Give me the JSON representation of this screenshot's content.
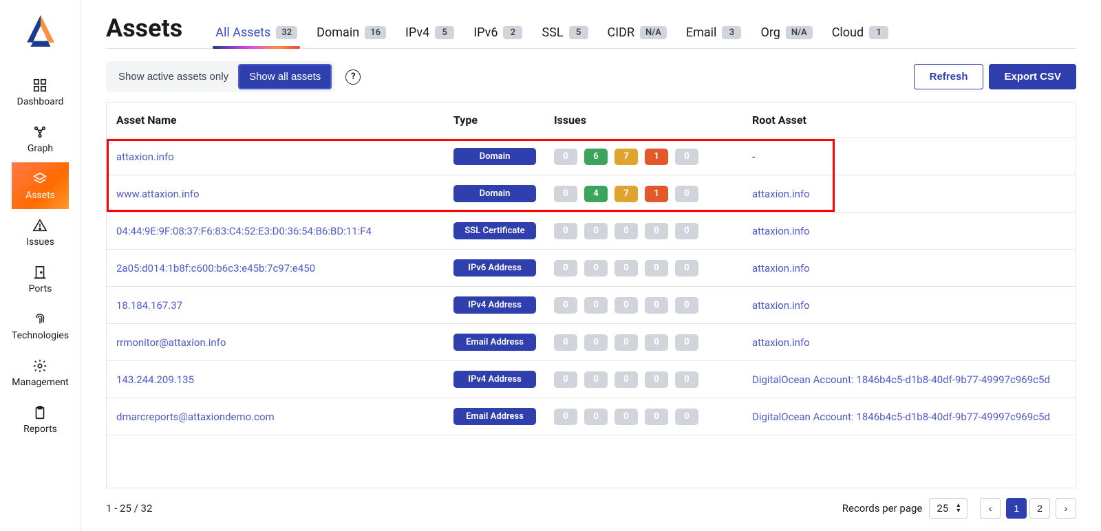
{
  "sidebar": {
    "items": [
      {
        "label": "Dashboard",
        "icon": "dashboard-icon"
      },
      {
        "label": "Graph",
        "icon": "graph-icon"
      },
      {
        "label": "Assets",
        "icon": "layers-icon",
        "active": true
      },
      {
        "label": "Issues",
        "icon": "alert-icon"
      },
      {
        "label": "Ports",
        "icon": "door-icon"
      },
      {
        "label": "Technologies",
        "icon": "fingerprint-icon"
      },
      {
        "label": "Management",
        "icon": "gear-icon"
      },
      {
        "label": "Reports",
        "icon": "clipboard-icon"
      }
    ]
  },
  "header": {
    "title": "Assets",
    "tabs": [
      {
        "label": "All Assets",
        "count": "32",
        "active": true
      },
      {
        "label": "Domain",
        "count": "16"
      },
      {
        "label": "IPv4",
        "count": "5"
      },
      {
        "label": "IPv6",
        "count": "2"
      },
      {
        "label": "SSL",
        "count": "5"
      },
      {
        "label": "CIDR",
        "count": "N/A"
      },
      {
        "label": "Email",
        "count": "3"
      },
      {
        "label": "Org",
        "count": "N/A"
      },
      {
        "label": "Cloud",
        "count": "1"
      }
    ]
  },
  "toolbar": {
    "show_active_label": "Show active assets only",
    "show_all_label": "Show all assets",
    "help_symbol": "?",
    "refresh_label": "Refresh",
    "export_label": "Export CSV"
  },
  "table": {
    "columns": {
      "name": "Asset Name",
      "type": "Type",
      "issues": "Issues",
      "root": "Root Asset"
    },
    "rows": [
      {
        "name": "attaxion.info",
        "type": "Domain",
        "issues": [
          "0",
          "6",
          "7",
          "1",
          "0"
        ],
        "issue_colors": [
          "gray",
          "green",
          "yellow",
          "orange",
          "gray"
        ],
        "root": "-"
      },
      {
        "name": "www.attaxion.info",
        "type": "Domain",
        "issues": [
          "0",
          "4",
          "7",
          "1",
          "0"
        ],
        "issue_colors": [
          "gray",
          "green",
          "yellow",
          "orange",
          "gray"
        ],
        "root": "attaxion.info"
      },
      {
        "name": "04:44:9E:9F:08:37:F6:83:C4:52:E3:D0:36:54:B6:BD:11:F4",
        "type": "SSL Certificate",
        "issues": [
          "0",
          "0",
          "0",
          "0",
          "0"
        ],
        "issue_colors": [
          "gray",
          "gray",
          "gray",
          "gray",
          "gray"
        ],
        "root": "attaxion.info"
      },
      {
        "name": "2a05:d014:1b8f:c600:b6c3:e45b:7c97:e450",
        "type": "IPv6 Address",
        "issues": [
          "0",
          "0",
          "0",
          "0",
          "0"
        ],
        "issue_colors": [
          "gray",
          "gray",
          "gray",
          "gray",
          "gray"
        ],
        "root": "attaxion.info"
      },
      {
        "name": "18.184.167.37",
        "type": "IPv4 Address",
        "issues": [
          "0",
          "0",
          "0",
          "0",
          "0"
        ],
        "issue_colors": [
          "gray",
          "gray",
          "gray",
          "gray",
          "gray"
        ],
        "root": "attaxion.info"
      },
      {
        "name": "rrmonitor@attaxion.info",
        "type": "Email Address",
        "issues": [
          "0",
          "0",
          "0",
          "0",
          "0"
        ],
        "issue_colors": [
          "gray",
          "gray",
          "gray",
          "gray",
          "gray"
        ],
        "root": "attaxion.info"
      },
      {
        "name": "143.244.209.135",
        "type": "IPv4 Address",
        "issues": [
          "0",
          "0",
          "0",
          "0",
          "0"
        ],
        "issue_colors": [
          "gray",
          "gray",
          "gray",
          "gray",
          "gray"
        ],
        "root": "DigitalOcean Account: 1846b4c5-d1b8-40df-9b77-49997c969c5d"
      },
      {
        "name": "dmarcreports@attaxiondemo.com",
        "type": "Email Address",
        "issues": [
          "0",
          "0",
          "0",
          "0",
          "0"
        ],
        "issue_colors": [
          "gray",
          "gray",
          "gray",
          "gray",
          "gray"
        ],
        "root": "DigitalOcean Account: 1846b4c5-d1b8-40df-9b77-49997c969c5d"
      }
    ]
  },
  "footer": {
    "range_text": "1 - 25 / 32",
    "rpp_label": "Records per page",
    "rpp_value": "25",
    "pages": [
      "1",
      "2"
    ],
    "current_page": "1"
  }
}
